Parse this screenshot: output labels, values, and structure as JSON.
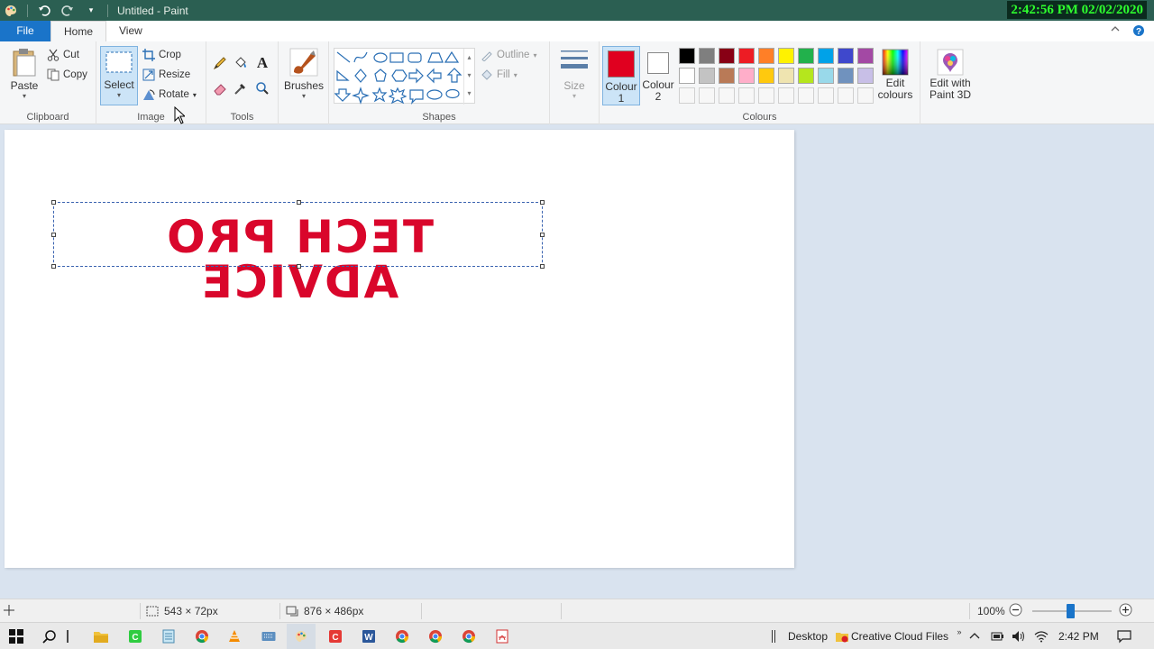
{
  "window": {
    "title": "Untitled - Paint",
    "clock": "2:42:56 PM 02/02/2020"
  },
  "tabs": [
    {
      "label": "File"
    },
    {
      "label": "Home"
    },
    {
      "label": "View"
    }
  ],
  "clipboard": {
    "paste": "Paste",
    "cut": "Cut",
    "copy": "Copy",
    "group_label": "Clipboard"
  },
  "image": {
    "select": "Select",
    "crop": "Crop",
    "resize": "Resize",
    "rotate": "Rotate",
    "group_label": "Image"
  },
  "tools": {
    "group_label": "Tools"
  },
  "brushes": {
    "label": "Brushes"
  },
  "shapes": {
    "outline": "Outline",
    "fill": "Fill",
    "group_label": "Shapes"
  },
  "size": {
    "label": "Size"
  },
  "colours": {
    "colour1": "Colour 1",
    "colour2": "Colour 2",
    "colour1_value": "#e0001f",
    "colour2_value": "#ffffff",
    "palette_row1": [
      "#000000",
      "#7f7f7f",
      "#880015",
      "#ed1c24",
      "#ff7f27",
      "#fff200",
      "#22b14c",
      "#00a2e8",
      "#3f48cc",
      "#a349a4"
    ],
    "palette_row2": [
      "#ffffff",
      "#c3c3c3",
      "#b97a57",
      "#ffaec9",
      "#ffc90e",
      "#efe4b0",
      "#b5e61d",
      "#99d9ea",
      "#7092be",
      "#c8bfe7"
    ],
    "edit_colours": "Edit colours",
    "group_label": "Colours"
  },
  "paint3d": {
    "label": "Edit with Paint 3D"
  },
  "canvas": {
    "text": "TECH PRO ADVICE",
    "text_color": "#d9062b"
  },
  "status": {
    "selection_size": "543 × 72px",
    "canvas_size": "876 × 486px",
    "zoom": "100%"
  },
  "taskbar": {
    "desktop": "Desktop",
    "creative_cloud": "Creative Cloud Files",
    "time": "2:42 PM"
  }
}
